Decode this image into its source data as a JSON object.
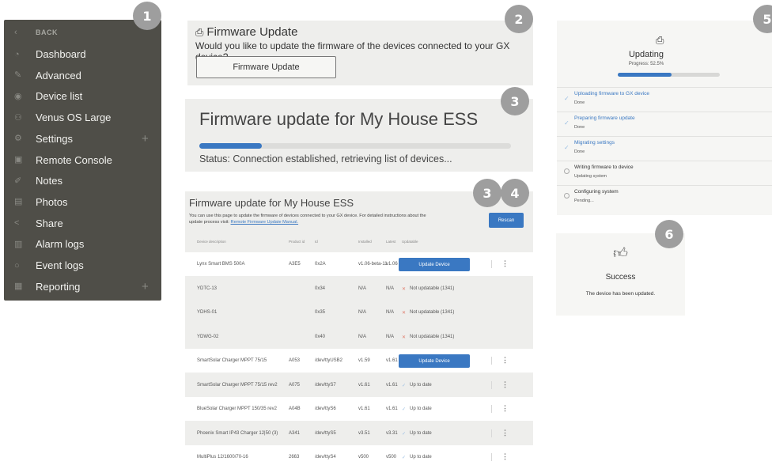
{
  "badges": [
    "1",
    "2",
    "3",
    "3",
    "4",
    "5",
    "6"
  ],
  "sidebar": {
    "back": "BACK",
    "items": [
      {
        "label": "Dashboard",
        "icon": "dashboard-icon",
        "glyph": "◔",
        "plus": ""
      },
      {
        "label": "Advanced",
        "icon": "advanced-icon",
        "glyph": "✎",
        "plus": ""
      },
      {
        "label": "Device list",
        "icon": "device-list-icon",
        "glyph": "◉",
        "plus": ""
      },
      {
        "label": "Venus OS Large",
        "icon": "venus-os-icon",
        "glyph": "⚇",
        "plus": ""
      },
      {
        "label": "Settings",
        "icon": "settings-icon",
        "glyph": "⚙",
        "plus": "+"
      },
      {
        "label": "Remote Console",
        "icon": "remote-console-icon",
        "glyph": "▣",
        "plus": ""
      },
      {
        "label": "Notes",
        "icon": "notes-icon",
        "glyph": "✐",
        "plus": ""
      },
      {
        "label": "Photos",
        "icon": "photos-icon",
        "glyph": "▤",
        "plus": ""
      },
      {
        "label": "Share",
        "icon": "share-icon",
        "glyph": "<",
        "plus": ""
      },
      {
        "label": "Alarm logs",
        "icon": "alarm-logs-icon",
        "glyph": "▥",
        "plus": ""
      },
      {
        "label": "Event logs",
        "icon": "event-logs-icon",
        "glyph": "○",
        "plus": ""
      },
      {
        "label": "Reporting",
        "icon": "reporting-icon",
        "glyph": "▦",
        "plus": "+"
      }
    ]
  },
  "panel2": {
    "title": "Firmware Update",
    "description": "Would you like to update the firmware of the devices connected to your GX device?",
    "button": "Firmware Update"
  },
  "panel3": {
    "title": "Firmware update for My House ESS",
    "progress_fraction": 0.2,
    "status": "Status: Connection established, retrieving list of devices..."
  },
  "panel4": {
    "title": "Firmware update for My House ESS",
    "intro_text": "You can use this page to update the firmware of devices connected to your GX device. For detailed instructions about the update process visit: ",
    "intro_link": "Remote Firmware Update Manual.",
    "rescan": "Rescan",
    "columns": [
      "Device description",
      "Product id",
      "Id",
      "Installed",
      "Latest",
      "Updatable"
    ],
    "rows": [
      {
        "desc": "Lynx Smart BMS 500A",
        "pid": "A3E5",
        "id": "0x2A",
        "inst": "v1.06-beta-11",
        "latest": "v1.06",
        "status": "",
        "action": "Update Device",
        "kind": "button",
        "menu": "⋮"
      },
      {
        "desc": "YDTC-13",
        "pid": "",
        "id": "0x34",
        "inst": "N/A",
        "latest": "N/A",
        "status": "Not updatable (1341)",
        "action": "",
        "kind": "x",
        "menu": ""
      },
      {
        "desc": "YDHS-01",
        "pid": "",
        "id": "0x35",
        "inst": "N/A",
        "latest": "N/A",
        "status": "Not updatable (1341)",
        "action": "",
        "kind": "x",
        "menu": ""
      },
      {
        "desc": "YDWG-02",
        "pid": "",
        "id": "0x40",
        "inst": "N/A",
        "latest": "N/A",
        "status": "Not updatable (1341)",
        "action": "",
        "kind": "x",
        "menu": ""
      },
      {
        "desc": "SmartSolar Charger MPPT 75/15",
        "pid": "A053",
        "id": "/dev/ttyUSB2",
        "inst": "v1.59",
        "latest": "v1.61",
        "status": "",
        "action": "Update Device",
        "kind": "button",
        "menu": "⋮"
      },
      {
        "desc": "SmartSolar Charger MPPT 75/15 rev2",
        "pid": "A075",
        "id": "/dev/ttyS7",
        "inst": "v1.61",
        "latest": "v1.61",
        "status": "Up to date",
        "action": "",
        "kind": "check",
        "menu": "⋮"
      },
      {
        "desc": "BlueSolar Charger MPPT 150/35 rev2",
        "pid": "A04B",
        "id": "/dev/ttyS6",
        "inst": "v1.61",
        "latest": "v1.61",
        "status": "Up to date",
        "action": "",
        "kind": "check",
        "menu": "⋮"
      },
      {
        "desc": "Phoenix Smart IP43 Charger 12|50 (3)",
        "pid": "A341",
        "id": "/dev/ttyS5",
        "inst": "v3.51",
        "latest": "v3.31",
        "status": "Up to date",
        "action": "",
        "kind": "check",
        "menu": "⋮"
      },
      {
        "desc": "MultiPlus 12/1600/70-16",
        "pid": "2663",
        "id": "/dev/ttyS4",
        "inst": "v500",
        "latest": "v500",
        "status": "Up to date",
        "action": "",
        "kind": "check",
        "menu": "⋮"
      }
    ]
  },
  "panel5": {
    "title": "Updating",
    "progress_label": "Progress: 52.5%",
    "progress_fraction": 0.525,
    "steps": [
      {
        "title": "Uploading firmware to GX device",
        "detail": "Done",
        "state": "done"
      },
      {
        "title": "Preparing firmware update",
        "detail": "Done",
        "state": "done"
      },
      {
        "title": "Migrating settings",
        "detail": "Done",
        "state": "done"
      },
      {
        "title": "Writing firmware to device",
        "detail": "Updating system",
        "state": "todo"
      },
      {
        "title": "Configuring system",
        "detail": "Pending...",
        "state": "todo"
      }
    ]
  },
  "panel6": {
    "title": "Success",
    "description": "The device has been updated."
  },
  "colors": {
    "accent": "#3a78c2",
    "sidebar": "#4f4e48",
    "badge": "#9e9e9e"
  }
}
